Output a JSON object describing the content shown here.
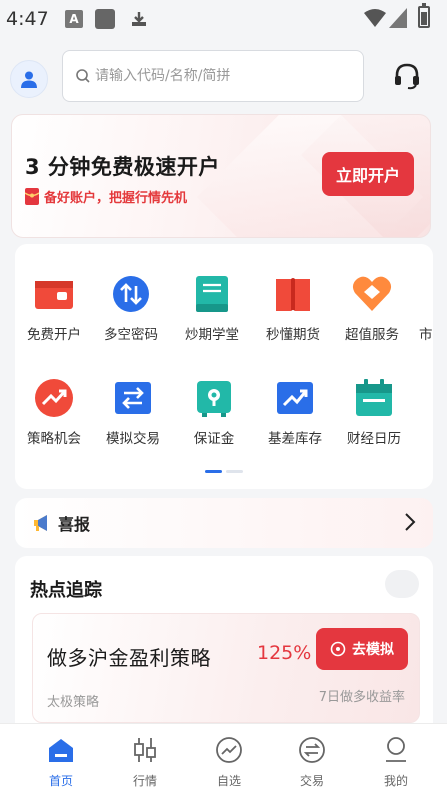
{
  "status_bar": {
    "time": "4:47",
    "a_icon": "A"
  },
  "header": {
    "avatar_icon": "user-icon",
    "search_placeholder": "请输入代码/名称/简拼",
    "support_icon": "headset-icon"
  },
  "banner": {
    "title": "3 分钟免费极速开户",
    "subtitle": "备好账户，把握行情先机",
    "button": "立即开户"
  },
  "features": [
    {
      "label": "免费开户",
      "icon": "wallet-icon",
      "color": "#f04a3a"
    },
    {
      "label": "多空密码",
      "icon": "swap-vertical-icon",
      "color": "#2a6ee8"
    },
    {
      "label": "炒期学堂",
      "icon": "book-icon",
      "color": "#22b8a8"
    },
    {
      "label": "秒懂期货",
      "icon": "open-book-icon",
      "color": "#f04a3a"
    },
    {
      "label": "超值服务",
      "icon": "heart-icon",
      "color": "#ff8a3d"
    },
    {
      "label": "市",
      "icon": "more-icon",
      "color": "#333333"
    },
    {
      "label": "策略机会",
      "icon": "trend-up-icon",
      "color": "#f04a3a"
    },
    {
      "label": "模拟交易",
      "icon": "swap-horizontal-icon",
      "color": "#2a6ee8"
    },
    {
      "label": "保证金",
      "icon": "safe-icon",
      "color": "#22b8a8"
    },
    {
      "label": "基差库存",
      "icon": "chart-up-icon",
      "color": "#2a6ee8"
    },
    {
      "label": "财经日历",
      "icon": "calendar-icon",
      "color": "#22b8a8"
    }
  ],
  "news": {
    "label": "喜报"
  },
  "hot": {
    "title": "热点追踪",
    "strategy": {
      "name": "做多沪金盈利策略",
      "return": "125%",
      "button": "去模拟",
      "author": "太极策略",
      "metric": "7日做多收益率"
    }
  },
  "bottom_nav": [
    {
      "label": "首页",
      "icon": "home-icon",
      "active": true
    },
    {
      "label": "行情",
      "icon": "candlestick-icon",
      "active": false
    },
    {
      "label": "自选",
      "icon": "trend-circle-icon",
      "active": false
    },
    {
      "label": "交易",
      "icon": "exchange-icon",
      "active": false
    },
    {
      "label": "我的",
      "icon": "profile-icon",
      "active": false
    }
  ],
  "colors": {
    "accent": "#e4373f",
    "brand_blue": "#2a6ee8",
    "teal": "#22b8a8"
  }
}
